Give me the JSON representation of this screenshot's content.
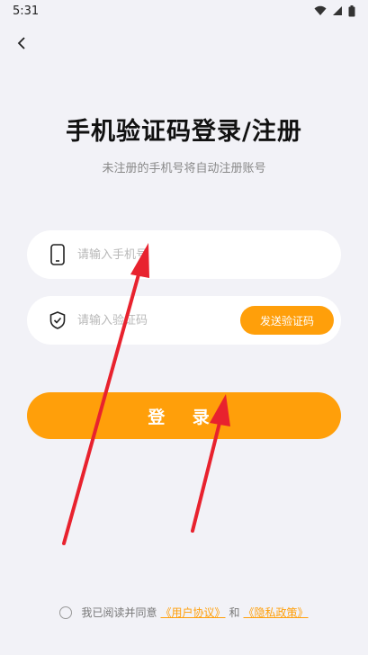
{
  "status_bar": {
    "time": "5:31"
  },
  "header": {
    "title": "手机验证码登录/注册",
    "subtitle": "未注册的手机号将自动注册账号"
  },
  "form": {
    "phone_placeholder": "请输入手机号",
    "code_placeholder": "请输入验证码",
    "send_code_label": "发送验证码",
    "login_label": "登 录"
  },
  "agreement": {
    "prefix": "我已阅读并同意",
    "user_agreement": "《用户协议》",
    "and": "和",
    "privacy_policy": "《隐私政策》"
  },
  "colors": {
    "accent": "#ff9f0a",
    "annotation_arrow": "#e8222e",
    "background": "#f2f2f7"
  },
  "icons": [
    "back-arrow-icon",
    "wifi-icon",
    "signal-icon",
    "battery-icon",
    "phone-icon",
    "shield-check-icon"
  ]
}
